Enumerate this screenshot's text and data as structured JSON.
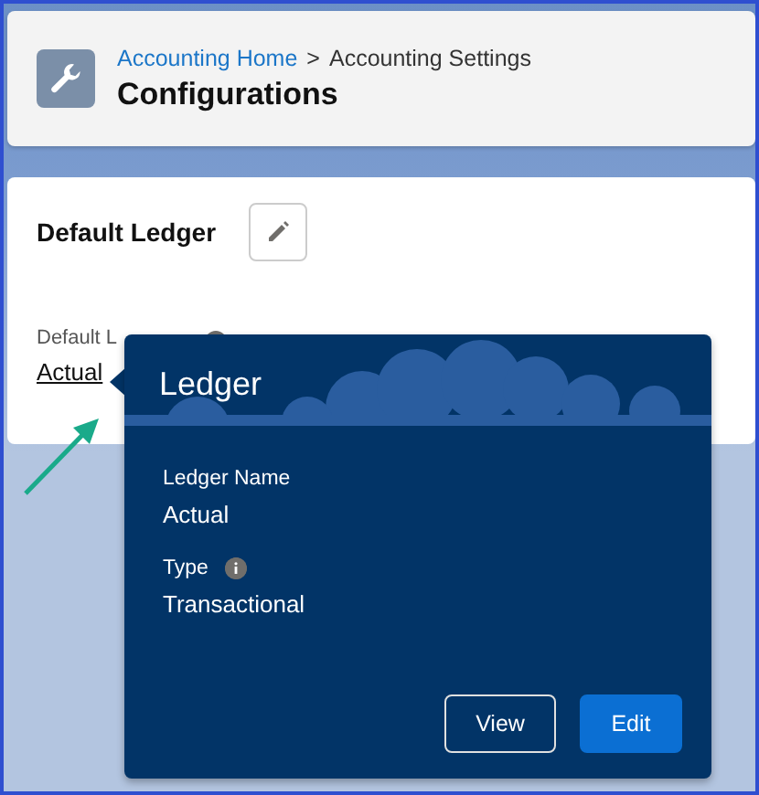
{
  "header": {
    "breadcrumb": [
      {
        "label": "Accounting Home",
        "kind": "link"
      },
      {
        "label": ">",
        "kind": "separator"
      },
      {
        "label": "Accounting Settings",
        "kind": "text"
      }
    ],
    "title": "Configurations"
  },
  "card": {
    "title": "Default Ledger",
    "field_label": "Default L",
    "field_value": "Actual"
  },
  "popover": {
    "title": "Ledger",
    "fields": [
      {
        "label": "Ledger Name",
        "value": "Actual",
        "info": false
      },
      {
        "label": "Type",
        "value": "Transactional",
        "info": true
      }
    ],
    "buttons": [
      {
        "label": "View",
        "kind": "neutral"
      },
      {
        "label": "Edit",
        "kind": "brand"
      }
    ]
  }
}
